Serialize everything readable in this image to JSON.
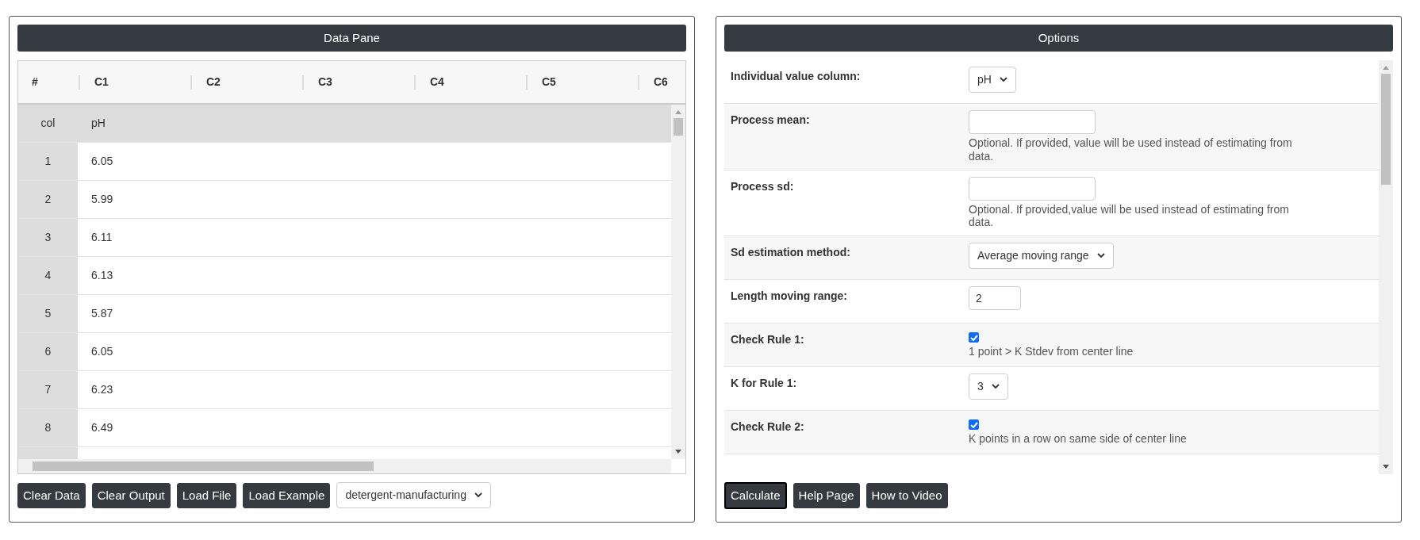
{
  "data_pane": {
    "title": "Data Pane",
    "columns": [
      "#",
      "C1",
      "C2",
      "C3",
      "C4",
      "C5",
      "C6"
    ],
    "name_row": {
      "label": "col",
      "values": [
        "pH"
      ]
    },
    "rows": [
      {
        "index": "1",
        "value": "6.05"
      },
      {
        "index": "2",
        "value": "5.99"
      },
      {
        "index": "3",
        "value": "6.11"
      },
      {
        "index": "4",
        "value": "6.13"
      },
      {
        "index": "5",
        "value": "5.87"
      },
      {
        "index": "6",
        "value": "6.05"
      },
      {
        "index": "7",
        "value": "6.23"
      },
      {
        "index": "8",
        "value": "6.49"
      }
    ],
    "buttons": [
      {
        "label": "Clear Data",
        "focused": false
      },
      {
        "label": "Clear Output",
        "focused": false
      },
      {
        "label": "Load File",
        "focused": false
      },
      {
        "label": "Load Example",
        "focused": false
      }
    ],
    "example_select": {
      "value": "detergent-manufacturing"
    }
  },
  "options": {
    "title": "Options",
    "fields": [
      {
        "label": "Individual value column:",
        "kind": "select",
        "value": "pH"
      },
      {
        "label": "Process mean:",
        "kind": "text",
        "help": "Optional. If provided, value will be used instead of estimating from data."
      },
      {
        "label": "Process sd:",
        "kind": "text",
        "help": "Optional. If provided,value will be used instead of estimating from data."
      },
      {
        "label": "Sd estimation method:",
        "kind": "select",
        "value": "Average moving range"
      },
      {
        "label": "Length moving range:",
        "kind": "text",
        "value": "2"
      },
      {
        "label": "Check Rule 1:",
        "kind": "checkbox",
        "checked": true,
        "help": "1 point > K Stdev from center line"
      },
      {
        "label": "K for Rule 1:",
        "kind": "select",
        "value": "3"
      },
      {
        "label": "Check Rule 2:",
        "kind": "checkbox",
        "checked": true,
        "help": "K points in a row on same side of center line"
      }
    ],
    "buttons": [
      {
        "label": "Calculate",
        "focused": true
      },
      {
        "label": "Help Page",
        "focused": false
      },
      {
        "label": "How to Video",
        "focused": false
      }
    ]
  }
}
